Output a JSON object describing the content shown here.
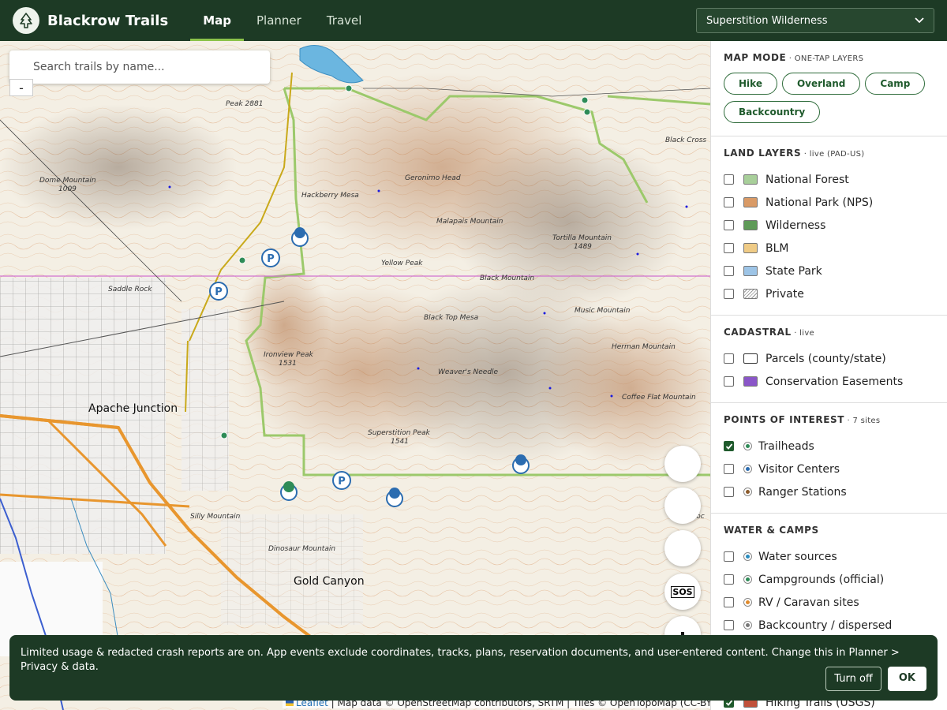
{
  "app": {
    "title": "Blackrow Trails"
  },
  "nav": {
    "tabs": [
      {
        "label": "Map",
        "active": true
      },
      {
        "label": "Planner",
        "active": false
      },
      {
        "label": "Travel",
        "active": false
      }
    ]
  },
  "region": {
    "selected": "Superstition Wilderness"
  },
  "search": {
    "placeholder": "Search trails by name..."
  },
  "map": {
    "zoom_out_label": "-",
    "sos_label": "SOS",
    "labels": [
      {
        "text": "Peak 2881"
      },
      {
        "text": "Dome Mountain"
      },
      {
        "text": "1009"
      },
      {
        "text": "Hackberry Mesa"
      },
      {
        "text": "Geronimo Head"
      },
      {
        "text": "Malapais Mountain"
      },
      {
        "text": "Tortilla Mountain"
      },
      {
        "text": "1489"
      },
      {
        "text": "Yellow Peak"
      },
      {
        "text": "Saddle Rock"
      },
      {
        "text": "Black Mountain"
      },
      {
        "text": "Black Top Mesa"
      },
      {
        "text": "Music Mountain"
      },
      {
        "text": "Herman Mountain"
      },
      {
        "text": "Ironview Peak"
      },
      {
        "text": "1531"
      },
      {
        "text": "Weaver's Needle"
      },
      {
        "text": "Coffee Flat Mountain"
      },
      {
        "text": "Superstition Peak"
      },
      {
        "text": "1541"
      },
      {
        "text": "Silly Mountain"
      },
      {
        "text": "Dinosaur Mountain"
      },
      {
        "text": "Black Cross"
      },
      {
        "text": "Roc"
      }
    ],
    "towns": [
      "Apache Junction",
      "Gold Canyon"
    ],
    "attribution": {
      "leaflet": "Leaflet",
      "rest": " | Map data © OpenStreetMap contributors, SRTM | Tiles © OpenTopoMap (CC-BY-SA)"
    }
  },
  "panel": {
    "map_mode": {
      "title": "MAP MODE",
      "subtitle": " · ONE-TAP LAYERS",
      "chips": [
        "Hike",
        "Overland",
        "Camp",
        "Backcountry"
      ]
    },
    "land_layers": {
      "title": "LAND LAYERS",
      "subtitle": " · live (PAD-US)",
      "items": [
        {
          "label": "National Forest",
          "color": "#a8cf9a",
          "checked": false
        },
        {
          "label": "National Park (NPS)",
          "color": "#d99a66",
          "checked": false
        },
        {
          "label": "Wilderness",
          "color": "#5f9a58",
          "checked": false
        },
        {
          "label": "BLM",
          "color": "#efcb86",
          "checked": false
        },
        {
          "label": "State Park",
          "color": "#9dc4e6",
          "checked": false
        },
        {
          "label": "Private",
          "color": "hatch",
          "checked": false
        }
      ]
    },
    "cadastral": {
      "title": "CADASTRAL",
      "subtitle": " · live",
      "items": [
        {
          "label": "Parcels (county/state)",
          "color": "#ffffff",
          "checked": false
        },
        {
          "label": "Conservation Easements",
          "color": "#8a56c8",
          "checked": false
        }
      ]
    },
    "poi": {
      "title": "POINTS OF INTEREST",
      "subtitle": " · 7 sites",
      "items": [
        {
          "label": "Trailheads",
          "color": "#2e8b57",
          "checked": true
        },
        {
          "label": "Visitor Centers",
          "color": "#2b6cb0",
          "checked": false
        },
        {
          "label": "Ranger Stations",
          "color": "#8b5a2b",
          "checked": false
        }
      ]
    },
    "water_camps": {
      "title": "WATER & CAMPS",
      "items": [
        {
          "label": "Water sources",
          "color": "#2b8cbe",
          "checked": false
        },
        {
          "label": "Campgrounds (official)",
          "color": "#2e8b57",
          "checked": false
        },
        {
          "label": "RV / Caravan sites",
          "color": "#e08a2c",
          "checked": false
        },
        {
          "label": "Backcountry / dispersed",
          "color": "#777777",
          "checked": false
        }
      ]
    },
    "bottom_item": {
      "label": "Hiking Trails (USGS)",
      "color": "#c0503a",
      "checked": true
    }
  },
  "banner": {
    "text": "Limited usage & redacted crash reports are on. App events exclude coordinates, tracks, plans, reservation documents, and user-entered content. Change this in Planner > Privacy & data.",
    "turn_off_label": "Turn off",
    "ok_label": "OK"
  }
}
